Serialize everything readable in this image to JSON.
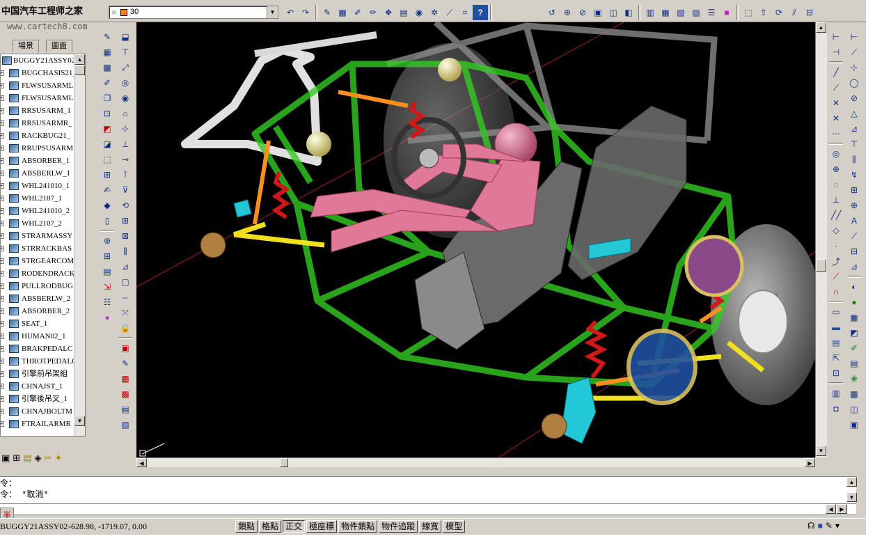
{
  "header": {
    "logo_text": "中国汽车工程师之家",
    "watermark": "www.cartech8.com",
    "layer_value": "30"
  },
  "tree": {
    "tabs": [
      "場景",
      "圖面"
    ],
    "items": [
      "BUGGY21ASSY02",
      "BUGCHASIS21_",
      "FLWSUSARML",
      "FLWSUSARML",
      "RRSUSARM_1",
      "RRSUSARMR_",
      "RACKBUG21_",
      "RRUPSUSARM",
      "ABSORBER_1",
      "ABSBERLW_1",
      "WHL241010_1",
      "WHL2107_1",
      "WHL241010_2",
      "WHL2107_2",
      "STRARMASSY",
      "STRRACKBAS",
      "STRGEARCOM",
      "RODENDRACK",
      "PULLRODBUG",
      "ABSBERLW_2",
      "ABSORBER_2",
      "SEAT_1",
      "HUMAN02_1",
      "BRAKPEDALC",
      "THROTPEDALC",
      "引擎前吊架組",
      "CHNAJST_1",
      "引擎後吊叉_1",
      "CHNAJBOLTM",
      "FTRAILARMR"
    ]
  },
  "command": {
    "line1": "令：",
    "line2": "令：  *取消*"
  },
  "mini_button": "半",
  "status": {
    "model": "BUGGY21ASSY02",
    "coords": "-628.98, -1719.07, 0.00",
    "toggles": [
      "鎖點",
      "格點",
      "正交",
      "極座標",
      "物件鎖點",
      "物件追蹤",
      "線寬",
      "模型"
    ]
  },
  "colors": {
    "frame": "#33cc22",
    "human": "#e07898",
    "seat": "#6a6a6a",
    "spring": "#d01818",
    "arm": "#f0e020",
    "accent_cyan": "#22c8d8"
  }
}
